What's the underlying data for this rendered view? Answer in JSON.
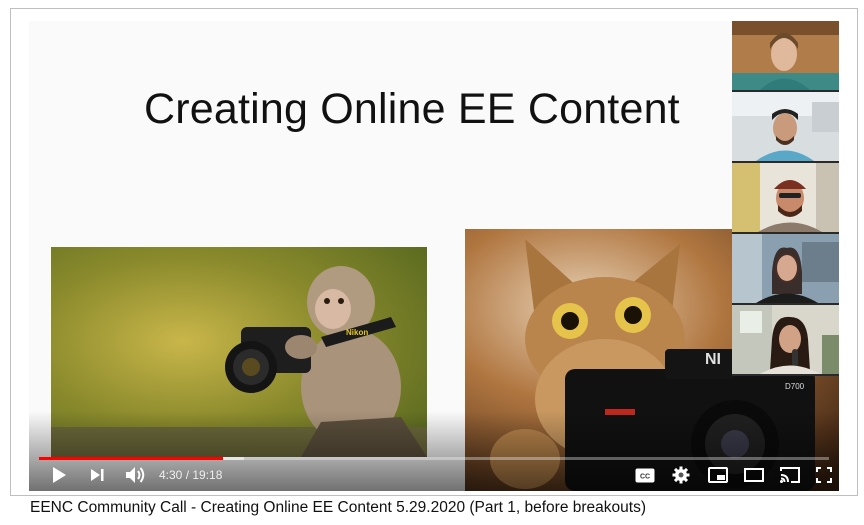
{
  "slide": {
    "title": "Creating Online EE Content"
  },
  "player": {
    "current_time": "4:30",
    "separator": " / ",
    "duration": "19:18",
    "progress_fraction": 0.233,
    "buffered_fraction": 0.26,
    "accent_color": "#ff0000"
  },
  "controls": {
    "icons": [
      "play-icon",
      "next-icon",
      "volume-icon",
      "captions-icon",
      "settings-icon",
      "miniplayer-icon",
      "theater-icon",
      "cast-icon",
      "fullscreen-icon"
    ],
    "cc_label": "CC"
  },
  "participants": {
    "count": 5
  },
  "video": {
    "title": "EENC Community Call - Creating Online EE Content 5.29.2020 (Part 1, before breakouts)"
  }
}
